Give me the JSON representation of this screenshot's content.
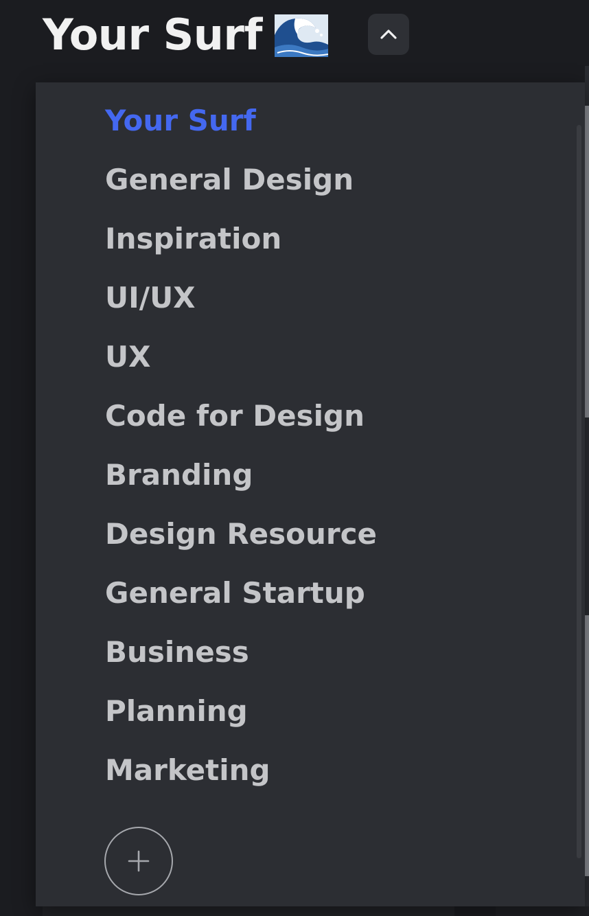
{
  "header": {
    "title": "Your Surf",
    "title_icon": "water-wave-icon",
    "collapse_icon": "chevron-up-icon"
  },
  "menu": {
    "items": [
      {
        "label": "Your Surf",
        "active": true
      },
      {
        "label": "General Design",
        "active": false
      },
      {
        "label": "Inspiration",
        "active": false
      },
      {
        "label": "UI/UX",
        "active": false
      },
      {
        "label": "UX",
        "active": false
      },
      {
        "label": "Code for Design",
        "active": false
      },
      {
        "label": "Branding",
        "active": false
      },
      {
        "label": "Design Resource",
        "active": false
      },
      {
        "label": "General Startup",
        "active": false
      },
      {
        "label": "Business",
        "active": false
      },
      {
        "label": "Planning",
        "active": false
      },
      {
        "label": "Marketing",
        "active": false
      }
    ],
    "add_icon": "plus-icon"
  },
  "colors": {
    "background": "#1b1c20",
    "dropdown": "#2c2e33",
    "active_item": "#4468f0",
    "item_text": "#c4c5c8",
    "title_text": "#f1f1f1"
  }
}
